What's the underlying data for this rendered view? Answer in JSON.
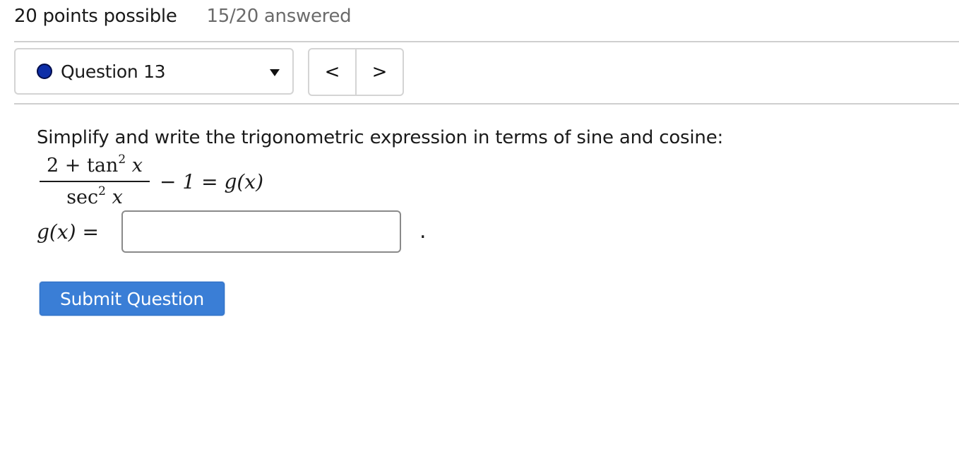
{
  "header": {
    "points_possible": "20 points possible",
    "answered": "15/20 answered"
  },
  "question_nav": {
    "selected": "Question 13",
    "status_color": "#0d2ea8",
    "prev_label": "<",
    "next_label": ">"
  },
  "question": {
    "prompt": "Simplify and write the trigonometric expression in terms of sine and cosine:",
    "numerator_const": "2 + tan",
    "numerator_exp": "2",
    "numerator_var": "x",
    "denominator_func": "sec",
    "denominator_exp": "2",
    "denominator_var": "x",
    "rest": "− 1 = g(x)",
    "answer_label": "g(x) =",
    "answer_value": "",
    "answer_suffix": "."
  },
  "actions": {
    "submit_label": "Submit Question",
    "submit_color": "#3a7ed6"
  }
}
